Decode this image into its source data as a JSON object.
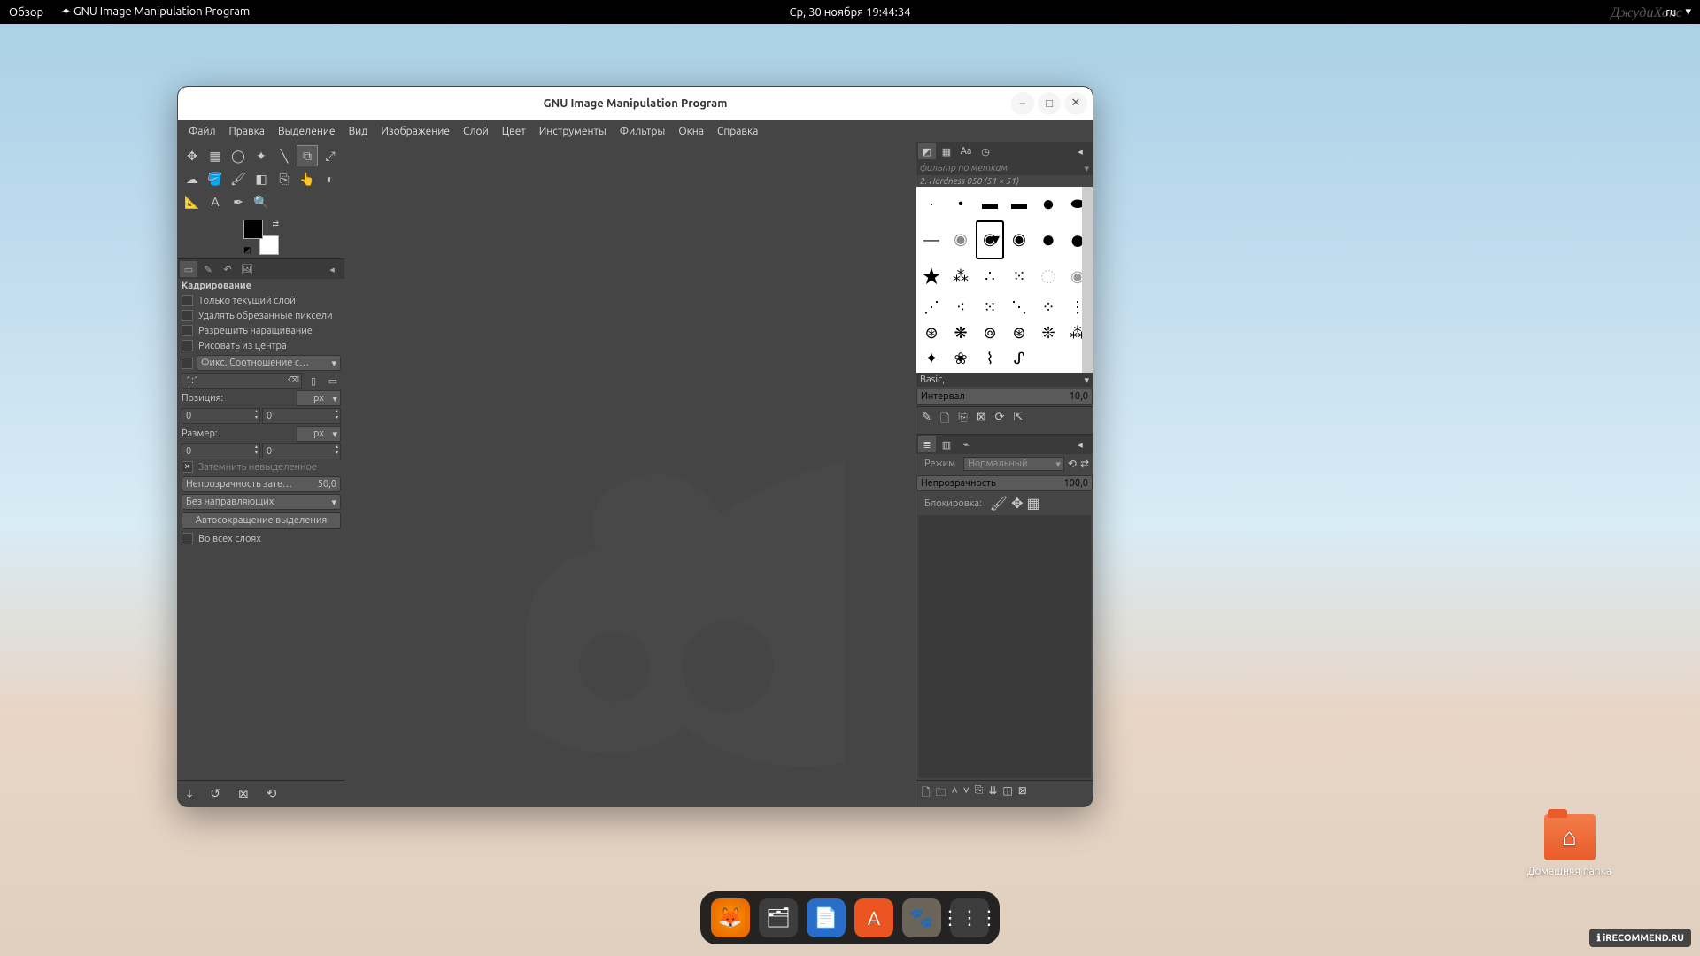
{
  "panel": {
    "overview": "Обзор",
    "app": "GNU Image Manipulation Program",
    "date": "Ср, 30 ноября  19:44:34",
    "lang": "ru"
  },
  "watermark_tr": "ДжудиХопс",
  "watermark_br": "iRECOMMEND.RU",
  "desktop": {
    "home": "Домашняя папка"
  },
  "dock": {
    "items": [
      "firefox",
      "files",
      "document",
      "software",
      "gimp",
      "applications"
    ]
  },
  "window": {
    "title": "GNU Image Manipulation Program",
    "menu": [
      "Файл",
      "Правка",
      "Выделение",
      "Вид",
      "Изображение",
      "Слой",
      "Цвет",
      "Инструменты",
      "Фильтры",
      "Окна",
      "Справка"
    ]
  },
  "tools": {
    "row1": [
      "move",
      "align",
      "lasso",
      "wand",
      "fuzzy",
      "crop",
      "transform"
    ],
    "row2": [
      "warp",
      "bucket",
      "brush",
      "eraser",
      "clone",
      "smudge",
      "dodge"
    ],
    "row3": [
      "measure",
      "text",
      "path",
      "zoom"
    ]
  },
  "tooloptions": {
    "title": "Кадрирование",
    "only_current": "Только текущий слой",
    "delete_cropped": "Удалять обрезанные пиксели",
    "allow_grow": "Разрешить наращивание",
    "from_center": "Рисовать из центра",
    "fixed": "Фикс.",
    "fixed_sel": "Соотношение с…",
    "ratio": "1:1",
    "position": "Позиция:",
    "px": "px",
    "posx": "0",
    "posy": "0",
    "size": "Размер:",
    "sx": "0",
    "sy": "0",
    "darken": "Затемнить невыделенное",
    "darken_opacity": "Непрозрачность зате…",
    "darken_val": "50,0",
    "guides": "Без направляющих",
    "autoshrink": "Автосокращение выделения",
    "all_layers": "Во всех слоях"
  },
  "bottom_buttons": [
    "save",
    "undo",
    "delete",
    "reset"
  ],
  "brushes": {
    "filter": "фильтр по меткам",
    "current": "2. Hardness 050 (51 × 51)",
    "set": "Basic,",
    "spacing_label": "Интервал",
    "spacing_val": "10,0",
    "actions": [
      "edit",
      "new",
      "dup",
      "del",
      "refresh",
      "menu"
    ]
  },
  "layers": {
    "mode_label": "Режим",
    "mode": "Нормальный",
    "opacity_label": "Непрозрачность",
    "opacity_val": "100,0",
    "lock_label": "Блокировка:",
    "buttons": [
      "new",
      "group",
      "up",
      "down",
      "dup",
      "anchor",
      "mask",
      "del"
    ]
  }
}
